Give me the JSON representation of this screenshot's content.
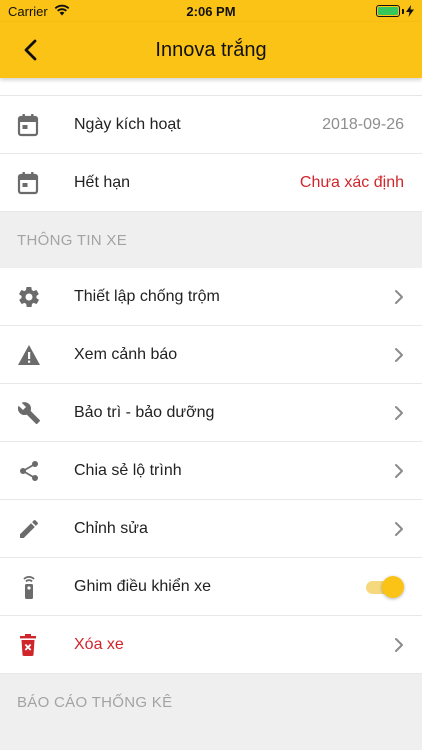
{
  "status_bar": {
    "carrier": "Carrier",
    "time": "2:06 PM"
  },
  "nav": {
    "title": "Innova trắng",
    "back_icon": "chevron-left-icon"
  },
  "info_rows": [
    {
      "icon": "calendar-icon",
      "label": "Ngày kích hoạt",
      "value": "2018-09-26",
      "value_color": "#8e8e8e"
    },
    {
      "icon": "calendar-icon",
      "label": "Hết hạn",
      "value": "Chưa xác định",
      "value_color": "#d0262b"
    }
  ],
  "sections": {
    "vehicle_info": "THÔNG TIN XE",
    "reports": "BÁO CÁO THỐNG KÊ"
  },
  "menu": [
    {
      "icon": "gear-icon",
      "label": "Thiết lập chống trộm"
    },
    {
      "icon": "warning-icon",
      "label": "Xem cảnh báo"
    },
    {
      "icon": "wrench-icon",
      "label": "Bảo trì - bảo dưỡng"
    },
    {
      "icon": "share-icon",
      "label": "Chia sẻ lộ trình"
    },
    {
      "icon": "pencil-icon",
      "label": "Chỉnh sửa"
    },
    {
      "icon": "remote-icon",
      "label": "Ghim điều khiển xe",
      "toggle_on": true
    },
    {
      "icon": "delete-icon",
      "label": "Xóa xe",
      "label_color": "#d0262b"
    }
  ],
  "colors": {
    "accent": "#fbc316",
    "danger": "#d0262b",
    "icon_gray": "#6b6b6b"
  }
}
